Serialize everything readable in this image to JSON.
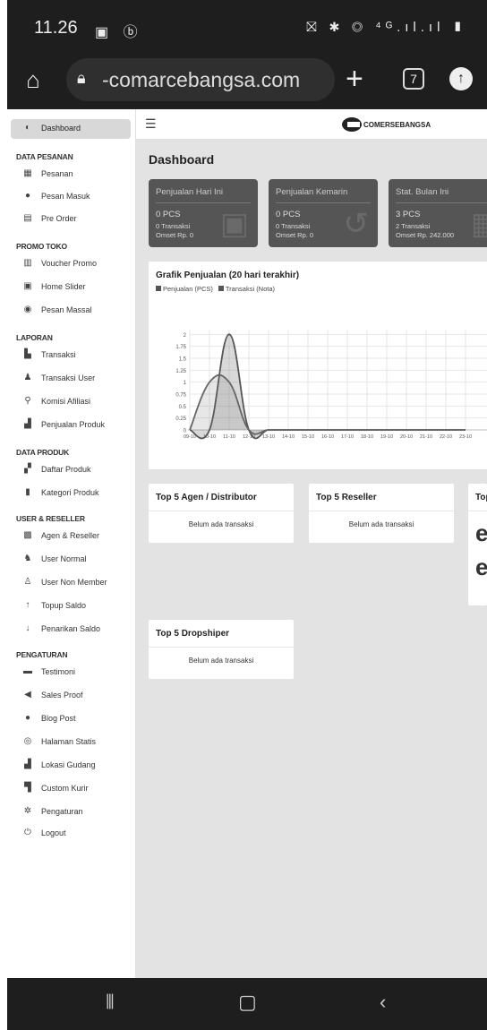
{
  "status": {
    "time": "11.26",
    "left_icons": "▣ ⓑ",
    "right_icons": "⛝ ✱ ◎ ⁴ᴳ.ıl.ıl ▮"
  },
  "browser": {
    "url": "-comarcebangsa.com",
    "tab_count": "7"
  },
  "topbar": {
    "brand": "COMERSEBANGSA"
  },
  "sidebar": {
    "dashboard": "Dashboard",
    "sections": {
      "pesanan": "DATA PESANAN",
      "promo": "PROMO TOKO",
      "laporan": "LAPORAN",
      "produk": "DATA PRODUK",
      "user": "USER & RESELLER",
      "pengaturan": "PENGATURAN"
    },
    "items": {
      "pesanan": "Pesanan",
      "pesan_masuk": "Pesan Masuk",
      "pre_order": "Pre Order",
      "voucher": "Voucher Promo",
      "home_slider": "Home Slider",
      "pesan_massal": "Pesan Massal",
      "transaksi": "Transaksi",
      "transaksi_user": "Transaksi User",
      "komisi": "Komisi Afiliasi",
      "penjualan_produk": "Penjualan Produk",
      "daftar_produk": "Daftar Produk",
      "kategori": "Kategori Produk",
      "agen": "Agen & Reseller",
      "user_normal": "User Normal",
      "user_non_member": "User Non Member",
      "topup": "Topup Saldo",
      "penarikan": "Penarikan Saldo",
      "testimoni": "Testimoni",
      "sales_proof": "Sales Proof",
      "blog": "Blog Post",
      "halaman": "Halaman Statis",
      "lokasi": "Lokasi Gudang",
      "kurir": "Custom Kurir",
      "pengaturan": "Pengaturan",
      "logout": "Logout"
    }
  },
  "page_title": "Dashboard",
  "stats": [
    {
      "title": "Penjualan Hari Ini",
      "pcs": "0 PCS",
      "transaksi": "0 Transaksi",
      "omset": "Omset Rp. 0"
    },
    {
      "title": "Penjualan Kemarin",
      "pcs": "0 PCS",
      "transaksi": "0 Transaksi",
      "omset": "Omset Rp. 0"
    },
    {
      "title": "Stat. Bulan Ini",
      "pcs": "3 PCS",
      "transaksi": "2 Transaksi",
      "omset": "Omset Rp. 242.000"
    }
  ],
  "chart_title": "Grafik Penjualan (20 hari terakhir)",
  "chart_data": {
    "type": "area",
    "title": "Grafik Penjualan (20 hari terakhir)",
    "categories": [
      "09-10",
      "10-10",
      "11-10",
      "12-10",
      "13-10",
      "14-10",
      "15-10",
      "16-10",
      "17-10",
      "18-10",
      "19-10",
      "20-10",
      "21-10",
      "22-10",
      "23-10"
    ],
    "series": [
      {
        "name": "Penjualan (PCS)",
        "values": [
          0,
          0,
          2,
          0,
          0,
          0,
          0,
          0,
          0,
          0,
          0,
          0,
          0,
          0,
          0
        ]
      },
      {
        "name": "Transaksi (Nota)",
        "values": [
          0,
          1,
          1,
          0,
          0,
          0,
          0,
          0,
          0,
          0,
          0,
          0,
          0,
          0,
          0
        ]
      }
    ],
    "y_ticks": [
      "0",
      "0.25",
      "0.5",
      "0.75",
      "1",
      "1.25",
      "1.5",
      "1.75",
      "2"
    ],
    "ylim": [
      0,
      2.1
    ],
    "grid": true,
    "legend": "top-left"
  },
  "top_cards": {
    "agen": {
      "title": "Top 5 Agen / Distributor",
      "empty": "Belum ada transaksi"
    },
    "reseller": {
      "title": "Top 5 Reseller",
      "empty": "Belum ada transaksi"
    },
    "third": {
      "title": "Top",
      "initial": "e"
    },
    "dropshiper": {
      "title": "Top 5 Dropshiper",
      "empty": "Belum ada transaksi"
    }
  },
  "colors": {
    "series": "#555555",
    "stat_bg": "#555555",
    "page_bg": "#e3e3e3"
  }
}
